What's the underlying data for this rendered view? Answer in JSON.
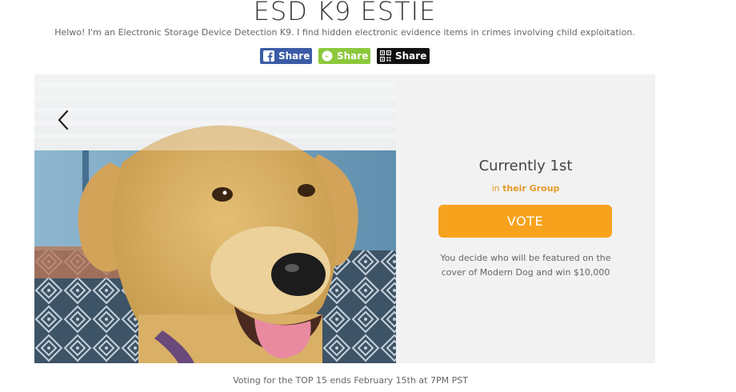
{
  "page": {
    "title": "ESD K9 ESTIE",
    "subtitle": "Helwo! I'm an Electronic Storage Device Detection K9. I find hidden electronic evidence items in crimes involving child exploitation."
  },
  "share": {
    "facebook_label": "Share",
    "messenger_label": "Share",
    "qr_label": "Share"
  },
  "vote_panel": {
    "rank_text": "Currently 1st",
    "group_prefix": "in",
    "group_link": "their Group",
    "vote_label": "VOTE",
    "description": "You decide who will be featured on the cover of Modern Dog and win $10,000"
  },
  "footer": {
    "deadline_text": "Voting for the TOP 15 ends February 15th at 7PM PST"
  },
  "colors": {
    "vote_button": "#f7a21d",
    "group_link": "#e39a2a",
    "facebook": "#3b5ba5",
    "messenger": "#8cc83c",
    "qr": "#111111"
  },
  "icons": {
    "facebook": "facebook-icon",
    "messenger": "messenger-icon",
    "qr": "qr-code-icon",
    "prev": "chevron-left-icon"
  }
}
